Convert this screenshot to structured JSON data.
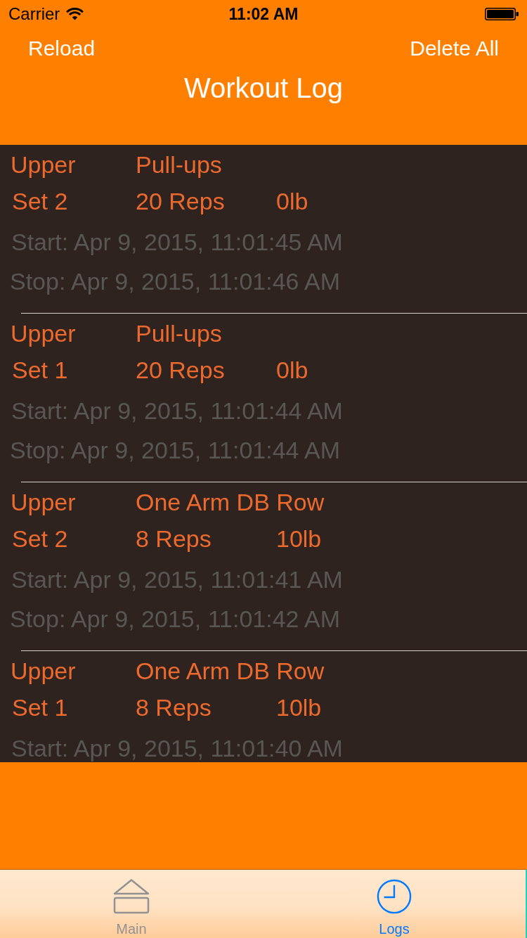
{
  "status_bar": {
    "carrier": "Carrier",
    "time": "11:02 AM"
  },
  "nav_bar": {
    "left_button": "Reload",
    "right_button": "Delete All",
    "title": "Workout Log"
  },
  "log_entries": [
    {
      "group": "Upper",
      "exercise": "Pull-ups",
      "set": "Set 2",
      "reps": "20 Reps",
      "weight": "0lb",
      "start": "Start: Apr 9, 2015, 11:01:45 AM",
      "stop": "Stop: Apr 9, 2015, 11:01:46 AM"
    },
    {
      "group": "Upper",
      "exercise": "Pull-ups",
      "set": "Set 1",
      "reps": "20 Reps",
      "weight": "0lb",
      "start": "Start: Apr 9, 2015, 11:01:44 AM",
      "stop": "Stop: Apr 9, 2015, 11:01:44 AM"
    },
    {
      "group": "Upper",
      "exercise": "One Arm DB Row",
      "set": "Set 2",
      "reps": "8 Reps",
      "weight": "10lb",
      "start": "Start: Apr 9, 2015, 11:01:41 AM",
      "stop": "Stop: Apr 9, 2015, 11:01:42 AM"
    },
    {
      "group": "Upper",
      "exercise": "One Arm DB Row",
      "set": "Set 1",
      "reps": "8 Reps",
      "weight": "10lb",
      "start": "Start: Apr 9, 2015, 11:01:40 AM"
    }
  ],
  "tab_bar": {
    "tabs": [
      {
        "label": "Main",
        "selected": false
      },
      {
        "label": "Logs",
        "selected": true
      }
    ]
  }
}
